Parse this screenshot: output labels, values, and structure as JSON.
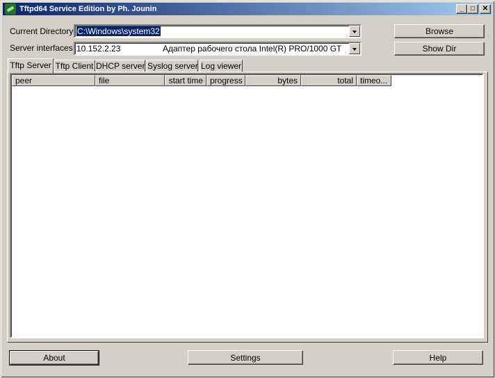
{
  "window": {
    "title": "Tftpd64 Service Edition by Ph. Jounin",
    "icon": "tftpd64-app-icon",
    "controls": {
      "minimize": "_",
      "maximize": "□",
      "close": "✕"
    }
  },
  "form": {
    "current_directory_label": "Current Directory",
    "current_directory_value": "C:\\Windows\\system32",
    "server_interfaces_label": "Server interfaces",
    "server_interfaces_ip": "10.152.2.23",
    "server_interfaces_adapter": "Адаптер рабочего стола Intel(R) PRO/1000 GT"
  },
  "buttons": {
    "browse": "Browse",
    "show_dir": "Show Dir",
    "about": "About",
    "settings": "Settings",
    "help": "Help"
  },
  "tabs": [
    {
      "label": "Tftp Server",
      "active": true
    },
    {
      "label": "Tftp Client",
      "active": false
    },
    {
      "label": "DHCP server",
      "active": false
    },
    {
      "label": "Syslog server",
      "active": false
    },
    {
      "label": "Log viewer",
      "active": false
    }
  ],
  "table": {
    "columns": [
      "peer",
      "file",
      "start time",
      "progress",
      "bytes",
      "total",
      "timeo..."
    ],
    "rows": []
  },
  "colors": {
    "face": "#d4d0c8",
    "title_start": "#0a246a",
    "title_end": "#a6caf0",
    "selection": "#0a246a"
  }
}
